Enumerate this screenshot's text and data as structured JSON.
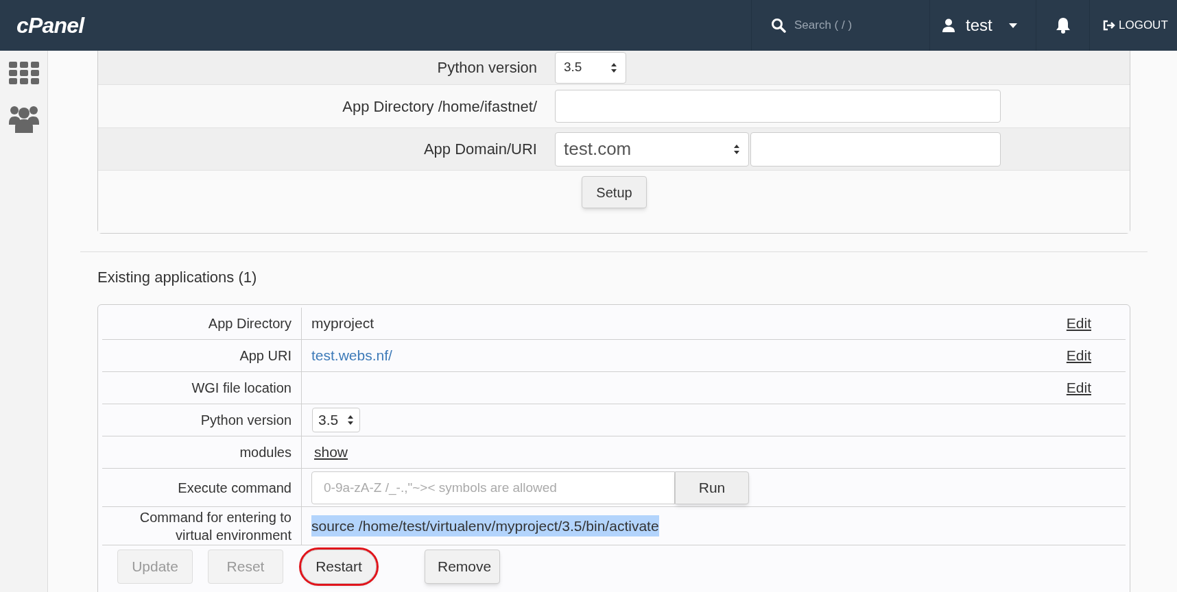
{
  "header": {
    "logo": "cPanel",
    "search": {
      "placeholder": "Search ( / )"
    },
    "user": "test",
    "logout": "LOGOUT"
  },
  "setup_form": {
    "rows": [
      {
        "kind": "select",
        "label": "Python version",
        "value": "3.5"
      },
      {
        "kind": "text",
        "label": "App Directory /home/ifastnet/"
      },
      {
        "kind": "domain",
        "label": "App Domain/URI",
        "value": "test.com"
      }
    ],
    "button": "Setup"
  },
  "existing": {
    "title": "Existing applications (1)",
    "rows": [
      {
        "kind": "text",
        "label": "App Directory",
        "value": "myproject",
        "action": "Edit"
      },
      {
        "kind": "url",
        "label": "App URI",
        "value": "test.webs.nf/",
        "action": "Edit"
      },
      {
        "kind": "text",
        "label": "WGI file location",
        "action": "Edit"
      },
      {
        "kind": "select",
        "label": "Python version",
        "value": "3.5"
      },
      {
        "kind": "toggle",
        "label": "modules",
        "value": "show"
      },
      {
        "kind": "command",
        "label": "Execute command",
        "placeholder": "0-9a-zA-Z /_-.,\"~>< symbols are allowed",
        "button": "Run"
      },
      {
        "kind": "text",
        "label": "Command for entering to virtual environment",
        "value": "source /home/test/virtualenv/myproject/3.5/bin/activate",
        "selected": true
      }
    ],
    "buttons": [
      {
        "label": "Update",
        "disabled": true,
        "highlighted": false
      },
      {
        "label": "Reset",
        "disabled": true,
        "highlighted": false
      },
      {
        "label": "Restart",
        "disabled": false,
        "highlighted": true
      },
      {
        "label": "Remove",
        "disabled": false,
        "highlighted": false
      }
    ]
  }
}
